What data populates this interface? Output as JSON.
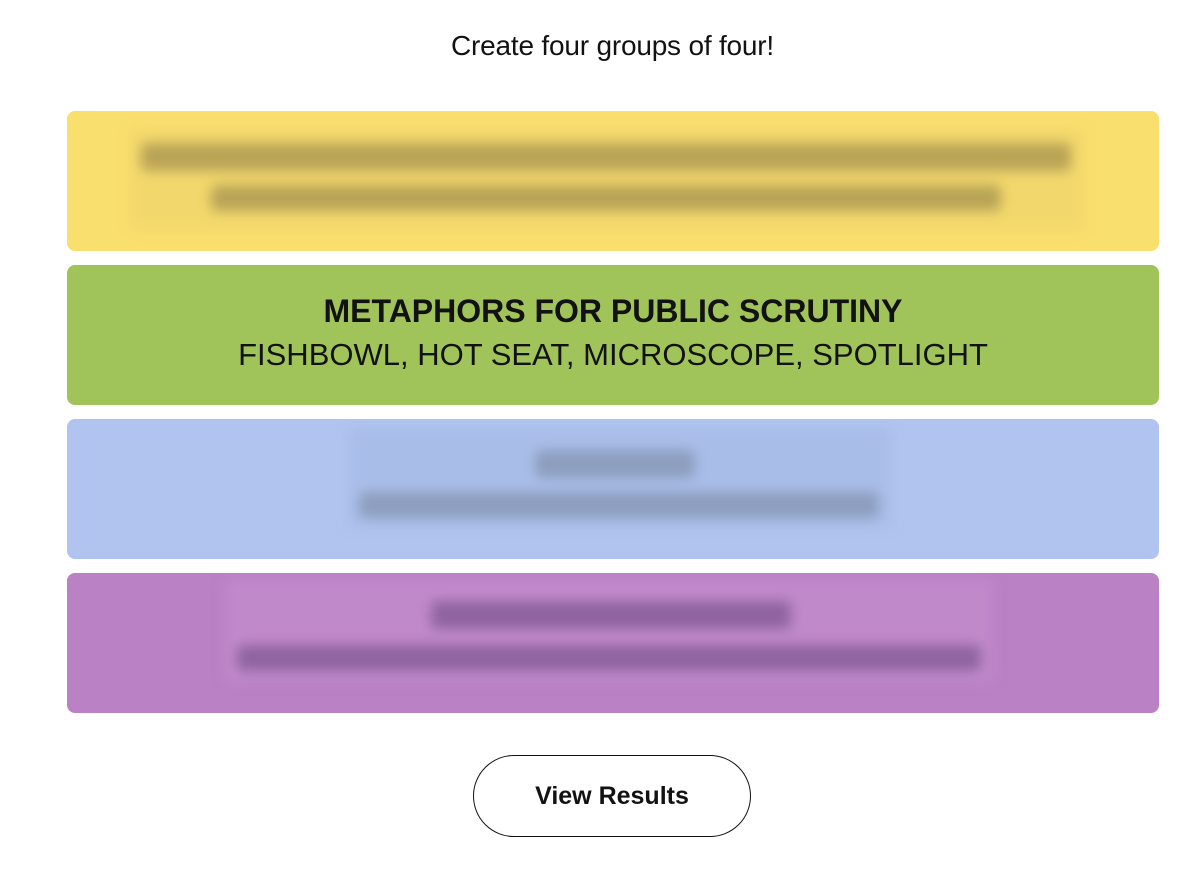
{
  "game": {
    "subtitle": "Create four groups of four!",
    "groups": [
      {
        "color_name": "yellow",
        "color": "#f9df6d",
        "revealed": false,
        "title": "",
        "members": ""
      },
      {
        "color_name": "green",
        "color": "#a0c35a",
        "revealed": true,
        "title": "METAPHORS FOR PUBLIC SCRUTINY",
        "members": "FISHBOWL, HOT SEAT, MICROSCOPE, SPOTLIGHT"
      },
      {
        "color_name": "blue",
        "color": "#b0c4ef",
        "revealed": false,
        "title": "",
        "members": ""
      },
      {
        "color_name": "purple",
        "color": "#ba81c5",
        "revealed": false,
        "title": "",
        "members": ""
      }
    ],
    "view_results_label": "View Results"
  }
}
